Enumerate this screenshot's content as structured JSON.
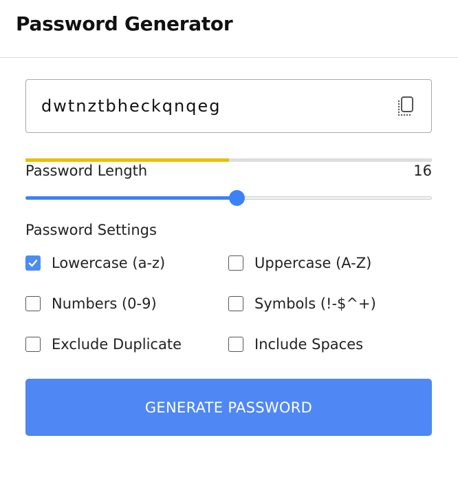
{
  "header": {
    "title": "Password Generator"
  },
  "password": {
    "value": "dwtnztbheckqnqeg",
    "copy_icon": "copy-icon"
  },
  "strength": {
    "level": 0.5,
    "color": "#e8c100"
  },
  "length": {
    "label": "Password Length",
    "value": "16",
    "slider_fraction": 0.52
  },
  "settings": {
    "title": "Password Settings",
    "options": [
      {
        "label": "Lowercase (a-z)",
        "checked": true
      },
      {
        "label": "Uppercase (A-Z)",
        "checked": false
      },
      {
        "label": "Numbers (0-9)",
        "checked": false
      },
      {
        "label": "Symbols (!-$^+)",
        "checked": false
      },
      {
        "label": "Exclude Duplicate",
        "checked": false
      },
      {
        "label": "Include Spaces",
        "checked": false
      }
    ]
  },
  "actions": {
    "generate_label": "GENERATE PASSWORD"
  },
  "colors": {
    "accent": "#3b82f6",
    "button": "#4f87f5",
    "checkbox_checked": "#4a8cf2"
  }
}
